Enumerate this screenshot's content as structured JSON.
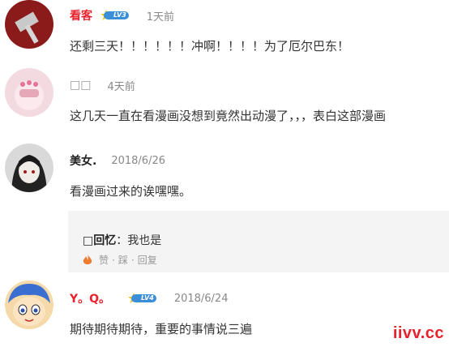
{
  "comments": [
    {
      "username": "看客",
      "level": "LV3",
      "time": "1天前",
      "text": "还剩三天！！！！！！冲啊！！！！为了厄尔巴东！"
    },
    {
      "username": "□□",
      "time": "4天前",
      "text": "这几天一直在看漫画没想到竟然出动漫了，，，表白这部漫画"
    },
    {
      "username": "美女.",
      "time": "2018/6/26",
      "text": "看漫画过来的诶嘿嘿。",
      "reply": {
        "username": "□回忆",
        "separator": "：",
        "text": "我也是",
        "actions": {
          "like": "赞",
          "dot1": "·",
          "step": "踩",
          "dot2": "·",
          "reply": "回复"
        }
      }
    },
    {
      "username": "Y。Q。",
      "level": "LV4",
      "time": "2018/6/24",
      "text": "期待期待期待，重要的事情说三遍"
    }
  ],
  "watermark": "iivv.cc"
}
